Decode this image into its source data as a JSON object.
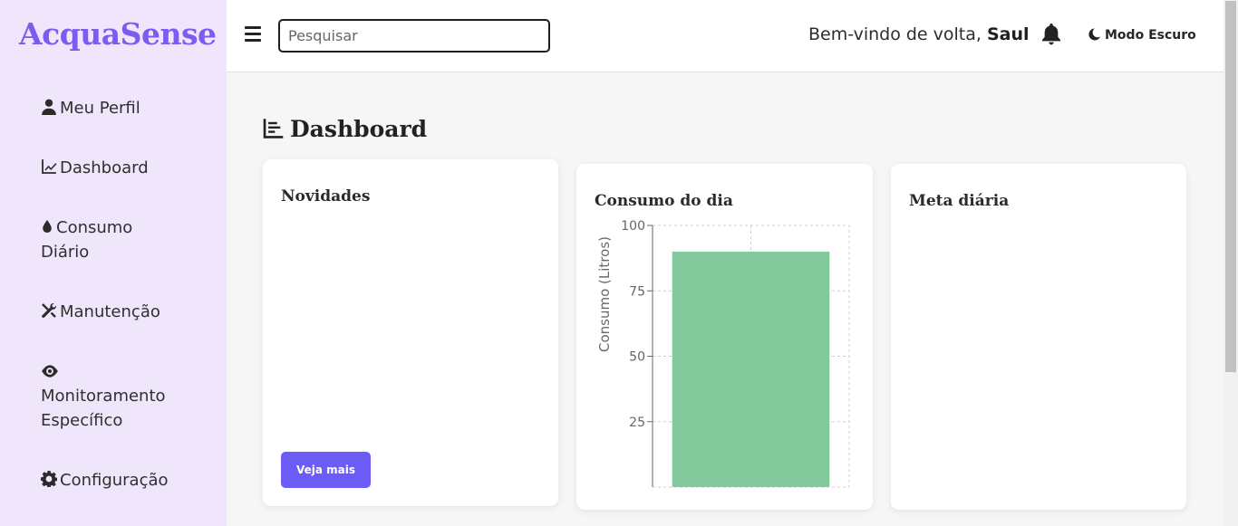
{
  "sidebar": {
    "brand": "AcquaSense",
    "items": [
      {
        "label": "Meu Perfil",
        "icon": "user-icon"
      },
      {
        "label": "Dashboard",
        "icon": "line-chart-icon"
      },
      {
        "label_lines": [
          "Consumo",
          "Diário"
        ],
        "icon": "water-drop-icon"
      },
      {
        "label": "Manutenção",
        "icon": "tools-icon"
      },
      {
        "label_lines": [
          "Monitoramento",
          "Específico"
        ],
        "icon": "eye-icon"
      },
      {
        "label": "Configuração",
        "icon": "gear-icon"
      }
    ]
  },
  "topbar": {
    "search_placeholder": "Pesquisar",
    "welcome_text": "Bem-vindo de volta,",
    "user_name": "Saul",
    "dark_mode_label": "Modo Escuro"
  },
  "main": {
    "title": "Dashboard",
    "cards": {
      "news": {
        "title": "Novidades",
        "button": "Veja mais"
      },
      "consumption": {
        "title": "Consumo do dia"
      },
      "goal": {
        "title": "Meta diária"
      }
    }
  },
  "colors": {
    "brand": "#7c5cf0",
    "sidebar_bg": "#efe6fc",
    "button": "#6c5cf5",
    "bar": "#84c99b"
  },
  "chart_data": {
    "type": "bar",
    "categories": [
      ""
    ],
    "values": [
      90
    ],
    "ylabel": "Consumo (Litros)",
    "yticks": [
      25,
      50,
      75,
      100
    ],
    "ylim": [
      0,
      100
    ],
    "grid": true
  }
}
